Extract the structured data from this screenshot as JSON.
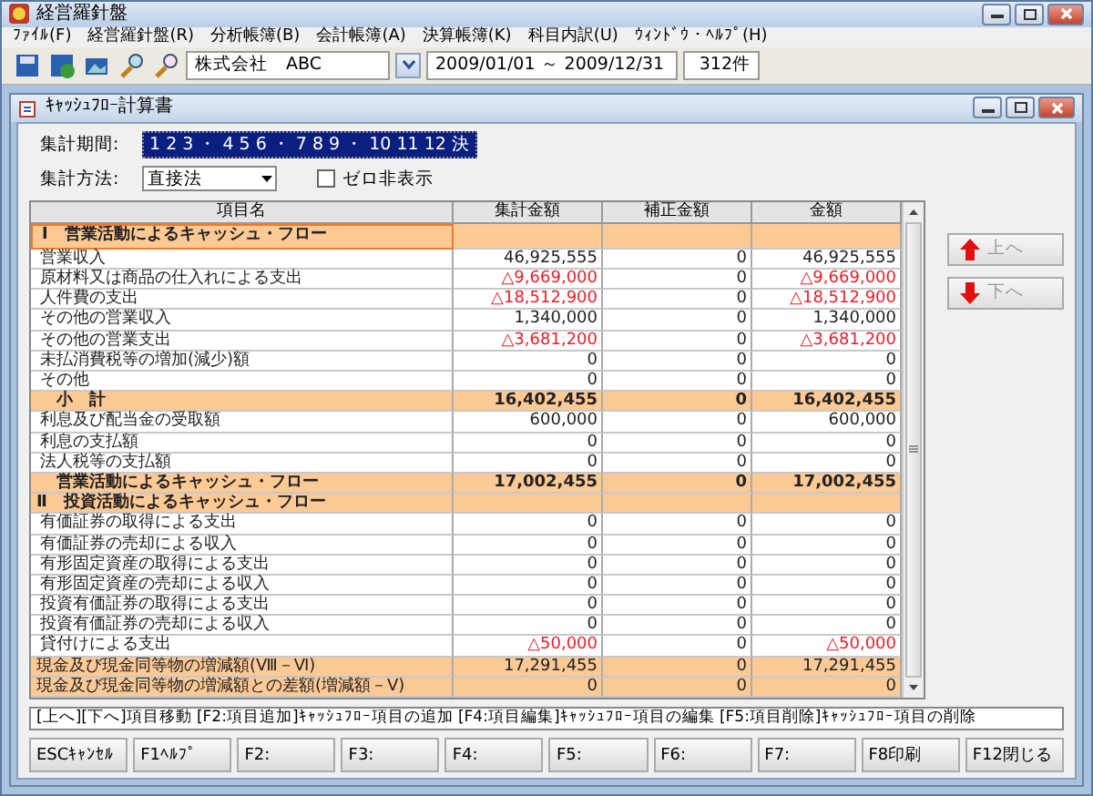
{
  "window": {
    "title": "経営羅針盤"
  },
  "menu": [
    "ﾌｧｲﾙ(F)",
    "経営羅針盤(R)",
    "分析帳簿(B)",
    "会計帳簿(A)",
    "決算帳簿(K)",
    "科目内訳(U)",
    "ｳｨﾝﾄﾞｳ・ﾍﾙﾌﾟ(H)"
  ],
  "toolbar": {
    "company": "株式会社　ABC",
    "period": "2009/01/01 ～ 2009/12/31",
    "count": "312件"
  },
  "child_window": {
    "title": "ｷｬｯｼｭﾌﾛｰ計算書"
  },
  "period": {
    "label": "集計期間:",
    "value": "1 2 3 ・ 4 5 6 ・ 7 8 9 ・ 10 11 12 決"
  },
  "method": {
    "label": "集計方法:",
    "value": "直接法"
  },
  "zero_hide": {
    "label": "ゼロ非表示",
    "checked": false
  },
  "table": {
    "columns": [
      "項目名",
      "集計金額",
      "補正金額",
      "金額"
    ],
    "rows": [
      {
        "kind": "section",
        "name": "Ⅰ　営業活動によるキャッシュ・フロー",
        "selected": true
      },
      {
        "kind": "item",
        "name": "営業収入",
        "selected": false,
        "cells": [
          {
            "text": "46,925,555",
            "negative": false
          },
          {
            "text": "0",
            "negative": false
          },
          {
            "text": "46,925,555",
            "negative": false
          }
        ]
      },
      {
        "kind": "item",
        "name": "原材料又は商品の仕入れによる支出",
        "selected": false,
        "cells": [
          {
            "text": "△9,669,000",
            "negative": true
          },
          {
            "text": "0",
            "negative": false
          },
          {
            "text": "△9,669,000",
            "negative": true
          }
        ]
      },
      {
        "kind": "item",
        "name": "人件費の支出",
        "selected": false,
        "cells": [
          {
            "text": "△18,512,900",
            "negative": true
          },
          {
            "text": "0",
            "negative": false
          },
          {
            "text": "△18,512,900",
            "negative": true
          }
        ]
      },
      {
        "kind": "item",
        "name": "その他の営業収入",
        "selected": false,
        "cells": [
          {
            "text": "1,340,000",
            "negative": false
          },
          {
            "text": "0",
            "negative": false
          },
          {
            "text": "1,340,000",
            "negative": false
          }
        ]
      },
      {
        "kind": "item",
        "name": "その他の営業支出",
        "selected": false,
        "cells": [
          {
            "text": "△3,681,200",
            "negative": true
          },
          {
            "text": "0",
            "negative": false
          },
          {
            "text": "△3,681,200",
            "negative": true
          }
        ]
      },
      {
        "kind": "item",
        "name": "未払消費税等の増加(減少)額",
        "selected": false,
        "cells": [
          {
            "text": "0",
            "negative": false
          },
          {
            "text": "0",
            "negative": false
          },
          {
            "text": "0",
            "negative": false
          }
        ]
      },
      {
        "kind": "item",
        "name": "その他",
        "selected": false,
        "cells": [
          {
            "text": "0",
            "negative": false
          },
          {
            "text": "0",
            "negative": false
          },
          {
            "text": "0",
            "negative": false
          }
        ]
      },
      {
        "kind": "subtotal",
        "name": "小　計",
        "selected": false,
        "cells": [
          {
            "text": "16,402,455",
            "negative": false
          },
          {
            "text": "0",
            "negative": false
          },
          {
            "text": "16,402,455",
            "negative": false
          }
        ]
      },
      {
        "kind": "item",
        "name": "利息及び配当金の受取額",
        "selected": false,
        "cells": [
          {
            "text": "600,000",
            "negative": false
          },
          {
            "text": "0",
            "negative": false
          },
          {
            "text": "600,000",
            "negative": false
          }
        ]
      },
      {
        "kind": "item",
        "name": "利息の支払額",
        "selected": false,
        "cells": [
          {
            "text": "0",
            "negative": false
          },
          {
            "text": "0",
            "negative": false
          },
          {
            "text": "0",
            "negative": false
          }
        ]
      },
      {
        "kind": "item",
        "name": "法人税等の支払額",
        "selected": false,
        "cells": [
          {
            "text": "0",
            "negative": false
          },
          {
            "text": "0",
            "negative": false
          },
          {
            "text": "0",
            "negative": false
          }
        ]
      },
      {
        "kind": "subtotal",
        "name": "営業活動によるキャッシュ・フロー",
        "selected": false,
        "cells": [
          {
            "text": "17,002,455",
            "negative": false
          },
          {
            "text": "0",
            "negative": false
          },
          {
            "text": "17,002,455",
            "negative": false
          }
        ]
      },
      {
        "kind": "section",
        "name": "Ⅱ　投資活動によるキャッシュ・フロー",
        "selected": false
      },
      {
        "kind": "item",
        "name": "有価証券の取得による支出",
        "selected": false,
        "cells": [
          {
            "text": "0",
            "negative": false
          },
          {
            "text": "0",
            "negative": false
          },
          {
            "text": "0",
            "negative": false
          }
        ]
      },
      {
        "kind": "item",
        "name": "有価証券の売却による収入",
        "selected": false,
        "cells": [
          {
            "text": "0",
            "negative": false
          },
          {
            "text": "0",
            "negative": false
          },
          {
            "text": "0",
            "negative": false
          }
        ]
      },
      {
        "kind": "item",
        "name": "有形固定資産の取得による支出",
        "selected": false,
        "cells": [
          {
            "text": "0",
            "negative": false
          },
          {
            "text": "0",
            "negative": false
          },
          {
            "text": "0",
            "negative": false
          }
        ]
      },
      {
        "kind": "item",
        "name": "有形固定資産の売却による収入",
        "selected": false,
        "cells": [
          {
            "text": "0",
            "negative": false
          },
          {
            "text": "0",
            "negative": false
          },
          {
            "text": "0",
            "negative": false
          }
        ]
      },
      {
        "kind": "item",
        "name": "投資有価証券の取得による支出",
        "selected": false,
        "cells": [
          {
            "text": "0",
            "negative": false
          },
          {
            "text": "0",
            "negative": false
          },
          {
            "text": "0",
            "negative": false
          }
        ]
      },
      {
        "kind": "item",
        "name": "投資有価証券の売却による収入",
        "selected": false,
        "cells": [
          {
            "text": "0",
            "negative": false
          },
          {
            "text": "0",
            "negative": false
          },
          {
            "text": "0",
            "negative": false
          }
        ]
      },
      {
        "kind": "item",
        "name": "貸付けによる支出",
        "selected": false,
        "cells": [
          {
            "text": "△50,000",
            "negative": true
          },
          {
            "text": "0",
            "negative": false
          },
          {
            "text": "△50,000",
            "negative": true
          }
        ]
      },
      {
        "kind": "summary",
        "name": "現金及び現金同等物の増減額(Ⅷ－Ⅵ)",
        "selected": false,
        "cells": [
          {
            "text": "17,291,455",
            "negative": false
          },
          {
            "text": "0",
            "negative": false
          },
          {
            "text": "17,291,455",
            "negative": false
          }
        ]
      },
      {
        "kind": "summary",
        "name": "現金及び現金同等物の増減額との差額(増減額－Ⅴ)",
        "selected": false,
        "cells": [
          {
            "text": "0",
            "negative": false
          },
          {
            "text": "0",
            "negative": false
          },
          {
            "text": "0",
            "negative": false
          }
        ]
      }
    ]
  },
  "side_buttons": [
    {
      "kind": "up",
      "label": "上へ",
      "disabled": true
    },
    {
      "kind": "down",
      "label": "下へ",
      "disabled": true
    }
  ],
  "status_text": "[上へ][下へ]項目移動 [F2:項目追加]ｷｬｯｼｭﾌﾛｰ項目の追加 [F4:項目編集]ｷｬｯｼｭﾌﾛｰ項目の編集 [F5:項目削除]ｷｬｯｼｭﾌﾛｰ項目の削除",
  "function_keys": [
    "ESCｷｬﾝｾﾙ",
    "F1ﾍﾙﾌﾟ",
    "F2:",
    "F3:",
    "F4:",
    "F5:",
    "F6:",
    "F7:",
    "F8印刷",
    "F12閉じる"
  ]
}
